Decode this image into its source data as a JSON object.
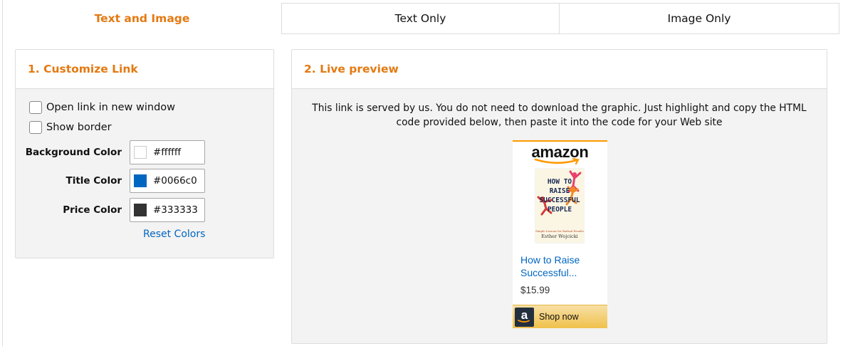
{
  "tabs": [
    {
      "label": "Text and Image",
      "active": true
    },
    {
      "label": "Text Only",
      "active": false
    },
    {
      "label": "Image Only",
      "active": false
    }
  ],
  "customize": {
    "header": "1. Customize Link",
    "open_new_window": {
      "label": "Open link in new window",
      "checked": false
    },
    "show_border": {
      "label": "Show border",
      "checked": false
    },
    "background_color": {
      "label": "Background Color",
      "value": "#ffffff"
    },
    "title_color": {
      "label": "Title Color",
      "value": "#0066c0"
    },
    "price_color": {
      "label": "Price Color",
      "value": "#333333"
    },
    "reset_label": "Reset Colors"
  },
  "preview": {
    "header": "2. Live preview",
    "description": "This link is served by us. You do not need to download the graphic. Just highlight and copy the HTML code provided below, then paste it into the code for your Web site",
    "widget": {
      "logo_text": "amazon",
      "cover_title_lines": [
        "HOW TO",
        "RAISE",
        "SUCCESSFUL",
        "PEOPLE"
      ],
      "cover_subtitle": "Simple Lessons for Radical Results",
      "cover_author": "Esther Wojcicki",
      "item_title": "How to Raise Successful...",
      "price": "$15.99",
      "shop_label": "Shop now",
      "shop_icon_letter": "a"
    }
  },
  "colors": {
    "accent": "#e47911",
    "link": "#0066c0",
    "button_top": "#f7dfa5",
    "button_bottom": "#f0c14b"
  }
}
